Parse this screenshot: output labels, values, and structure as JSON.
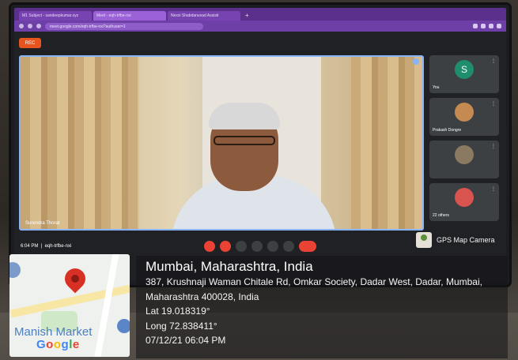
{
  "browser": {
    "tabs": [
      {
        "label": "M1 Subject - sandeepkumar.xyz"
      },
      {
        "label": "Meet - eqh-trfbe-nxi"
      },
      {
        "label": "Nexxi Shabdanuvad Assisti"
      }
    ],
    "url": "meet.google.com/eqh-trfbe-nxi?authuser=1"
  },
  "meet": {
    "record_label": "REC",
    "main_participant_name": "Surendra Thorat",
    "side_tiles": [
      {
        "initial": "S",
        "name": "You",
        "avatar_color": "#1e8e6e"
      },
      {
        "initial": "",
        "name": "Prakash Dongre",
        "avatar_color": "#c58a52"
      },
      {
        "initial": "",
        "name": "",
        "avatar_color": "#8a7a62"
      },
      {
        "initial": "",
        "name": "22 others",
        "avatar_color": "#d9534f"
      }
    ],
    "meeting_time": "6:04 PM",
    "meeting_code": "eqh-trfbe-nxi",
    "more_icon": "⋮"
  },
  "gps": {
    "app_name": "GPS Map Camera",
    "title": "Mumbai, Maharashtra, India",
    "address_line1": "387, Krushnaji Waman Chitale Rd, Omkar Society, Dadar West, Dadar,",
    "address_line2": "Mumbai, Maharashtra 400028, India",
    "lat": "Lat 19.018319°",
    "long": "Long 72.838411°",
    "datetime": "07/12/21 06:04 PM",
    "map_place_label": "Manish Market",
    "map_brand": "Google"
  }
}
